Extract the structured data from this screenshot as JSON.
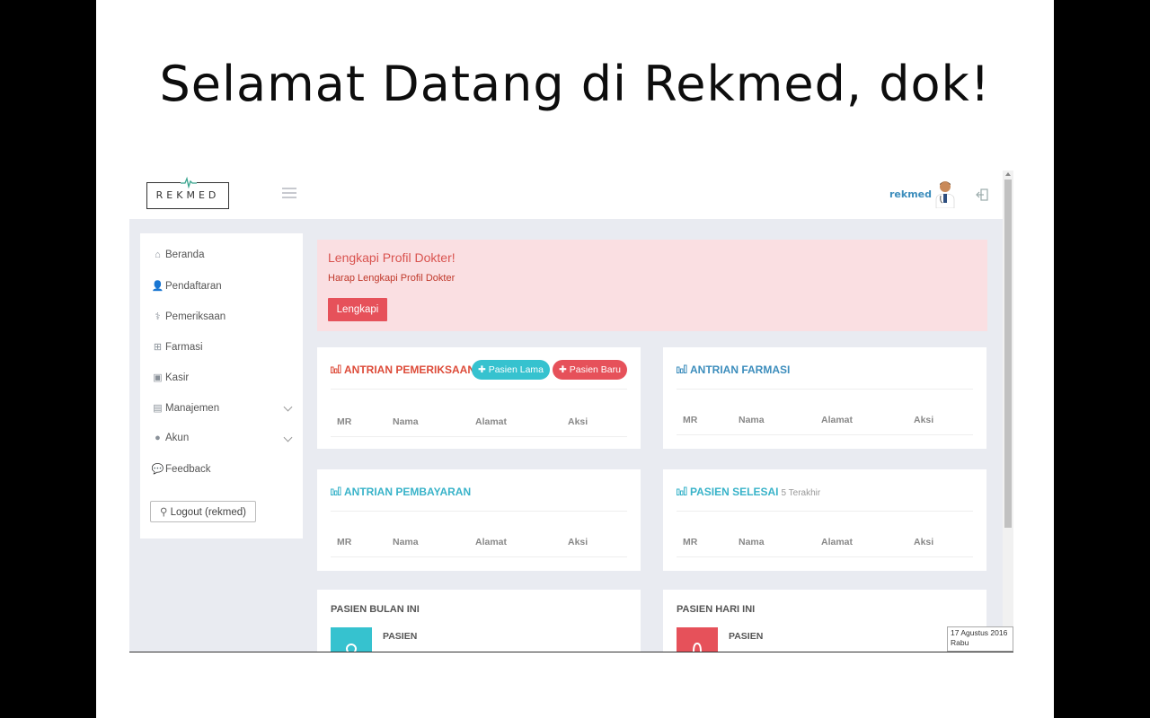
{
  "slide": {
    "title": "Selamat Datang di Rekmed, dok!"
  },
  "header": {
    "logo_text": "REKMED",
    "user_name": "rekmed",
    "brand_color": "#3c8dbc"
  },
  "sidebar": {
    "items": [
      {
        "label": "Beranda",
        "icon": "home-icon"
      },
      {
        "label": "Pendaftaran",
        "icon": "user-plus-icon"
      },
      {
        "label": "Pemeriksaan",
        "icon": "stethoscope-icon"
      },
      {
        "label": "Farmasi",
        "icon": "medkit-icon"
      },
      {
        "label": "Kasir",
        "icon": "money-icon"
      },
      {
        "label": "Manajemen",
        "icon": "clipboard-icon",
        "expandable": true
      },
      {
        "label": "Akun",
        "icon": "user-icon",
        "expandable": true
      },
      {
        "label": "Feedback",
        "icon": "comments-icon"
      }
    ],
    "logout_label": "Logout (rekmed)"
  },
  "alert": {
    "title": "Lengkapi Profil Dokter!",
    "message": "Harap Lengkapi Profil Dokter",
    "button": "Lengkapi",
    "bg_color": "#fadfe2"
  },
  "panels": {
    "antrian_pemeriksaan": {
      "title": "ANTRIAN PEMERIKSAAN",
      "btn_lama": "Pasien Lama",
      "btn_baru": "Pasien Baru",
      "columns": [
        "MR",
        "Nama",
        "Alamat",
        "Aksi"
      ],
      "color": "#dd4b39"
    },
    "antrian_farmasi": {
      "title": "ANTRIAN FARMASI",
      "columns": [
        "MR",
        "Nama",
        "Alamat",
        "Aksi"
      ],
      "color": "#3c8dbc"
    },
    "antrian_pembayaran": {
      "title": "ANTRIAN PEMBAYARAN",
      "columns": [
        "MR",
        "Nama",
        "Alamat",
        "Aksi"
      ],
      "color": "#39b3c9"
    },
    "pasien_selesai": {
      "title": "PASIEN SELESAI",
      "subtitle": "5 Terakhir",
      "columns": [
        "MR",
        "Nama",
        "Alamat",
        "Aksi"
      ],
      "color": "#39b3c9"
    },
    "pasien_bulan_ini": {
      "title": "PASIEN BULAN INI",
      "label": "PASIEN",
      "color": "#36c2cf"
    },
    "pasien_hari_ini": {
      "title": "PASIEN HARI INI",
      "label": "PASIEN",
      "color": "#e6515a"
    }
  },
  "taskbar_clock": {
    "date": "17 Agustus 2016",
    "day": "Rabu"
  }
}
